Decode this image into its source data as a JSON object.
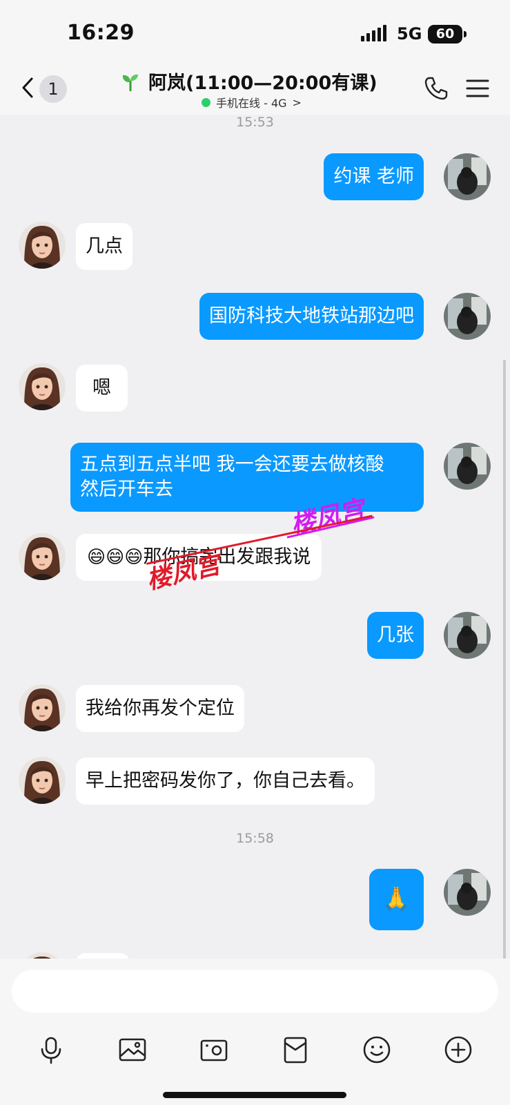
{
  "status_bar": {
    "time": "16:29",
    "network": "5G",
    "battery": "60"
  },
  "header": {
    "unread_count": "1",
    "contact_name": "阿岚(11:00—20:00有课)",
    "presence": "手机在线 - 4G",
    "chevron": ">"
  },
  "timestamps": [
    "15:53",
    "15:58"
  ],
  "messages": [
    {
      "side": "out",
      "text": "约课 老师"
    },
    {
      "side": "in",
      "text": "几点"
    },
    {
      "side": "out",
      "text": "国防科技大地铁站那边吧"
    },
    {
      "side": "in",
      "text": "嗯"
    },
    {
      "side": "out",
      "line1": "五点到五点半吧 我一会还要去做核酸",
      "line2": "然后开车去"
    },
    {
      "side": "in",
      "emojis": "😄😄😄",
      "text": "那你搞完出发跟我说"
    },
    {
      "side": "out",
      "text": "几张"
    },
    {
      "side": "in",
      "text": "我给你再发个定位"
    },
    {
      "side": "in",
      "text": "早上把密码发你了，你自己去看。"
    },
    {
      "side": "out",
      "text": "🙏"
    }
  ],
  "watermark": "楼凤宫",
  "colors": {
    "outgoing_bubble": "#0a99ff",
    "incoming_bubble": "#ffffff",
    "online": "#2dcf6a",
    "background": "#f0f0f2"
  },
  "toolbar_icons": [
    "microphone-icon",
    "image-icon",
    "camera-icon",
    "red-packet-icon",
    "emoji-icon",
    "plus-icon"
  ]
}
